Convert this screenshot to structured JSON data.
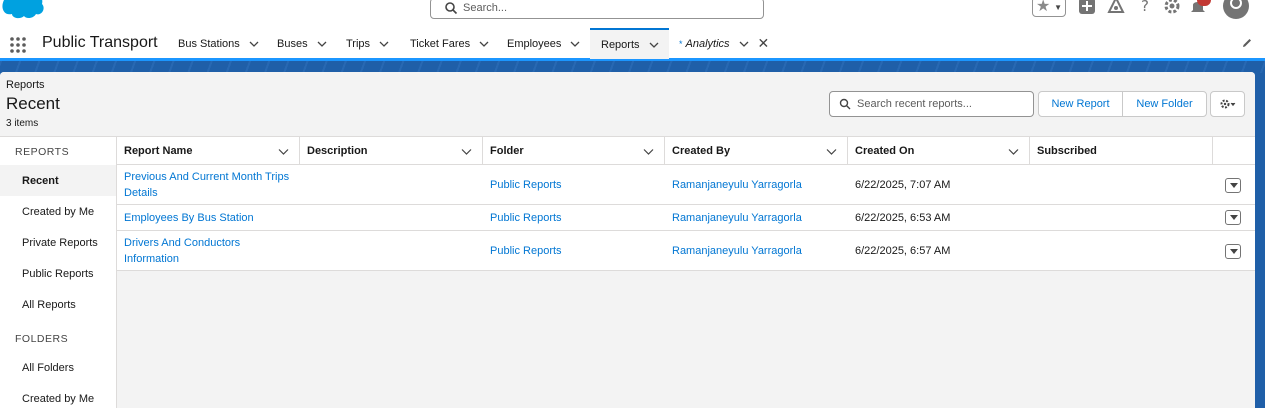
{
  "header": {
    "search_placeholder": "Search...",
    "notification_count": ""
  },
  "nav": {
    "app_name": "Public Transport",
    "items": [
      {
        "label": "Bus Stations"
      },
      {
        "label": "Buses"
      },
      {
        "label": "Trips"
      },
      {
        "label": "Ticket Fares"
      },
      {
        "label": "Employees"
      },
      {
        "label": "Reports"
      },
      {
        "label": "Analytics",
        "unsaved_mark": "*"
      }
    ]
  },
  "page": {
    "eyebrow": "Reports",
    "title": "Recent",
    "count": "3 items",
    "search_placeholder": "Search recent reports...",
    "new_report": "New Report",
    "new_folder": "New Folder"
  },
  "sidebar": {
    "reports_heading": "REPORTS",
    "report_items": [
      {
        "label": "Recent"
      },
      {
        "label": "Created by Me"
      },
      {
        "label": "Private Reports"
      },
      {
        "label": "Public Reports"
      },
      {
        "label": "All Reports"
      }
    ],
    "folders_heading": "FOLDERS",
    "folder_items": [
      {
        "label": "All Folders"
      },
      {
        "label": "Created by Me"
      }
    ]
  },
  "table": {
    "columns": [
      "Report Name",
      "Description",
      "Folder",
      "Created By",
      "Created On",
      "Subscribed"
    ],
    "rows": [
      {
        "name": "Previous And Current Month Trips Details",
        "description": "",
        "folder": "Public Reports",
        "created_by": "Ramanjaneyulu Yarragorla",
        "created_on": "6/22/2025, 7:07 AM",
        "subscribed": ""
      },
      {
        "name": "Employees By Bus Station",
        "description": "",
        "folder": "Public Reports",
        "created_by": "Ramanjaneyulu Yarragorla",
        "created_on": "6/22/2025, 6:53 AM",
        "subscribed": ""
      },
      {
        "name": "Drivers And Conductors Information",
        "description": "",
        "folder": "Public Reports",
        "created_by": "Ramanjaneyulu Yarragorla",
        "created_on": "6/22/2025, 6:57 AM",
        "subscribed": ""
      }
    ]
  },
  "colors": {
    "brand_blue": "#0176d3",
    "band_blue": "#1f5fa8",
    "nav_active_border": "#1b96ff"
  }
}
